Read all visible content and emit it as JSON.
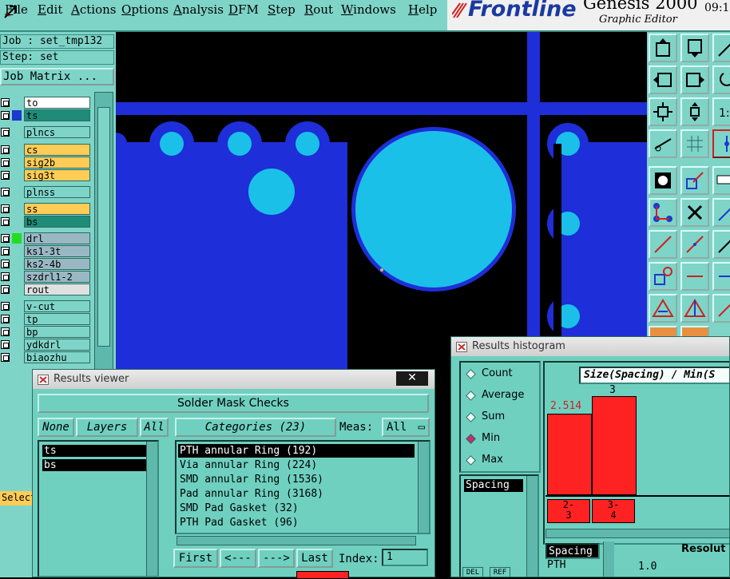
{
  "menubar": {
    "items": [
      "File",
      "Edit",
      "Actions",
      "Options",
      "Analysis",
      "DFM",
      "Step",
      "Rout",
      "Windows",
      "Help"
    ]
  },
  "brand": {
    "logo": "Frontline",
    "product": "Genesis 2000",
    "subtitle": "Graphic Editor",
    "time": "09:1"
  },
  "left": {
    "job": "Job : set_tmp132",
    "step": "Step: set",
    "job_matrix": "Job Matrix ...",
    "select": "Select",
    "layers": [
      {
        "name": "to",
        "bg": "#ffffff",
        "swatch": ""
      },
      {
        "name": "ts",
        "bg": "#1e8c78",
        "swatch": "#1a3ad0",
        "text": "#000"
      },
      {
        "name": "plncs",
        "bg": "#7fd4c8",
        "swatch": ""
      },
      {
        "name": "cs",
        "bg": "#ffcc55",
        "swatch": ""
      },
      {
        "name": "sig2b",
        "bg": "#ffcc55",
        "swatch": ""
      },
      {
        "name": "sig3t",
        "bg": "#ffcc55",
        "swatch": ""
      },
      {
        "name": "plnss",
        "bg": "#7fd4c8",
        "swatch": ""
      },
      {
        "name": "ss",
        "bg": "#ffcc55",
        "swatch": ""
      },
      {
        "name": "bs",
        "bg": "#1e8c78",
        "swatch": ""
      },
      {
        "name": "drl",
        "bg": "#9ab8c4",
        "swatch": "#22dd22"
      },
      {
        "name": "ks1-3t",
        "bg": "#9ab8c4",
        "swatch": ""
      },
      {
        "name": "ks2-4b",
        "bg": "#9ab8c4",
        "swatch": ""
      },
      {
        "name": "szdrl1-2",
        "bg": "#9ab8c4",
        "swatch": ""
      },
      {
        "name": "rout",
        "bg": "#e0e0e0",
        "swatch": ""
      },
      {
        "name": "v-cut",
        "bg": "#7fd4c8",
        "swatch": ""
      },
      {
        "name": "tp",
        "bg": "#7fd4c8",
        "swatch": ""
      },
      {
        "name": "bp",
        "bg": "#7fd4c8",
        "swatch": ""
      },
      {
        "name": "ydkdrl",
        "bg": "#7fd4c8",
        "swatch": ""
      },
      {
        "name": "biaozhu",
        "bg": "#7fd4c8",
        "swatch": ""
      }
    ]
  },
  "viewer": {
    "title": "Results viewer",
    "close": "✕",
    "header": "Solder Mask Checks",
    "none_btn": "None",
    "layers_btn": "Layers",
    "all_btn": "All",
    "categories_btn": "Categories (23)",
    "meas_label": "Meas:",
    "meas_value": "All",
    "layer_items": [
      "ts",
      "bs"
    ],
    "categories": [
      "PTH annular Ring (192)",
      "Via annular Ring (224)",
      "SMD annular Ring (1536)",
      "Pad annular Ring (3168)",
      "SMD Pad Gasket (32)",
      "PTH Pad Gasket (96)"
    ],
    "nav": {
      "first": "First",
      "prev": "<---",
      "next": "--->",
      "last": "Last"
    },
    "index_label": "Index:",
    "index_value": "1"
  },
  "histo": {
    "title": "Results histogram",
    "radios": [
      {
        "label": "Count",
        "on": false
      },
      {
        "label": "Average",
        "on": false
      },
      {
        "label": "Sum",
        "on": false
      },
      {
        "label": "Min",
        "on": true
      },
      {
        "label": "Max",
        "on": false
      }
    ],
    "list_item": "Spacing",
    "heading": "Size(Spacing) / Min(S",
    "bars": [
      {
        "value_label": "2.514",
        "bin": "2-\n3"
      },
      {
        "value_label": "3",
        "bin": "3-\n4"
      }
    ],
    "bottom_item": "Spacing",
    "bottom_sub": "PTH",
    "resolution_label": "Resolut",
    "resolution_value": "1.0",
    "del": "DEL",
    "ref": "REF"
  }
}
